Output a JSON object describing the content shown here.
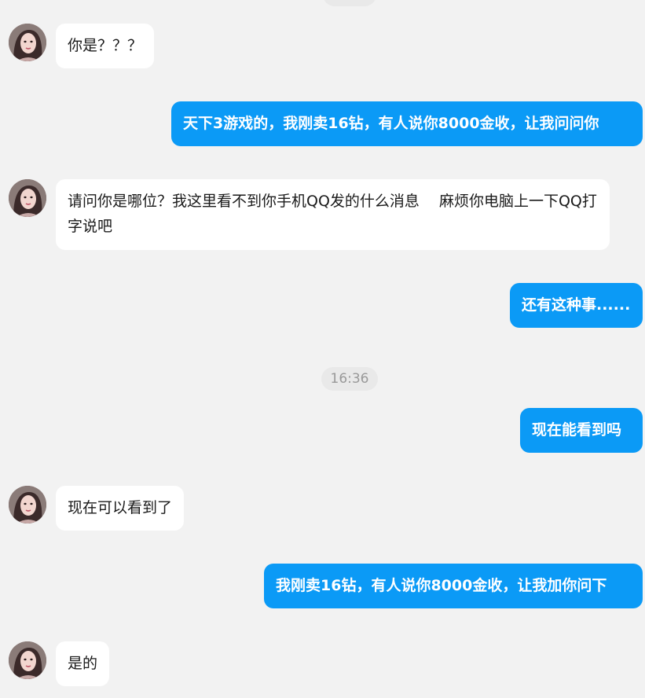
{
  "messages": [
    {
      "side": "in",
      "text": "你是？？？"
    },
    {
      "side": "out",
      "text": "天下3游戏的，我刚卖16钻，有人说你8000金收，让我问问你"
    },
    {
      "side": "in",
      "text": "请问你是哪位？我这里看不到你手机QQ发的什么消息　 麻烦你电脑上一下QQ打字说吧"
    },
    {
      "side": "out",
      "text": "还有这种事......"
    },
    {
      "side": "time",
      "text": "16:36"
    },
    {
      "side": "out",
      "text": "现在能看到吗"
    },
    {
      "side": "in",
      "text": "现在可以看到了"
    },
    {
      "side": "out",
      "text": "我刚卖16钻，有人说你8000金收，让我加你问下"
    },
    {
      "side": "in",
      "text": "是的"
    }
  ],
  "colors": {
    "background": "#f2f2f2",
    "outgoing_bubble": "#0b9af6",
    "incoming_bubble": "#ffffff",
    "timestamp_pill": "#e9e9e9",
    "timestamp_text": "#999999"
  },
  "icons": {
    "contact_avatar": "avatar-photo"
  }
}
